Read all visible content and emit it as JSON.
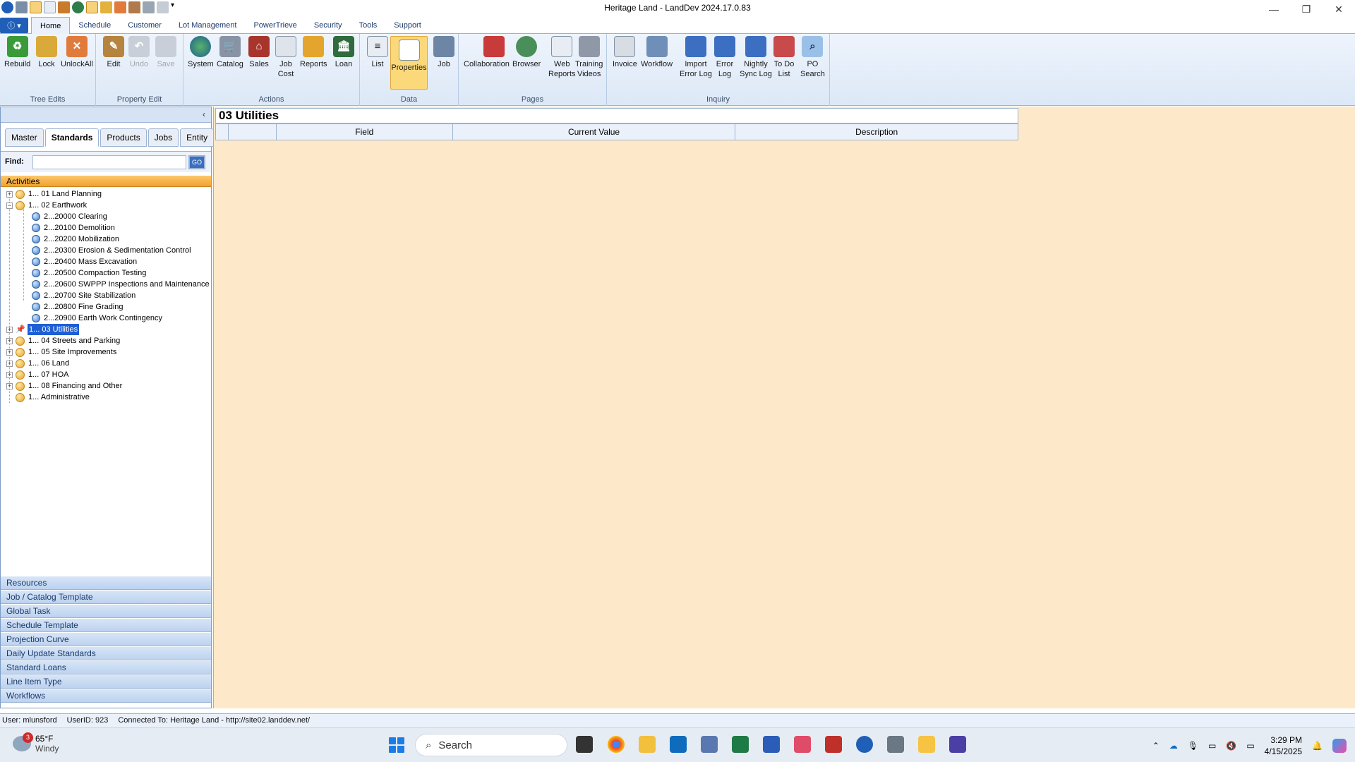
{
  "window": {
    "title": "Heritage Land - LandDev 2024.17.0.83",
    "controls": {
      "minimize": "—",
      "restore": "❐",
      "close": "✕"
    }
  },
  "app_menu_label": "ⓛ ▾",
  "ribbon_tabs": [
    "Home",
    "Schedule",
    "Customer",
    "Lot Management",
    "PowerTrieve",
    "Security",
    "Tools",
    "Support"
  ],
  "ribbon": {
    "groups": {
      "tree_edits": "Tree Edits",
      "property_edit": "Property Edit",
      "actions": "Actions",
      "data": "Data",
      "pages": "Pages",
      "inquiry": "Inquiry"
    },
    "buttons": {
      "rebuild": "Rebuild",
      "lock": "Lock",
      "unlockall": "UnlockAll",
      "edit": "Edit",
      "undo": "Undo",
      "save": "Save",
      "system": "System",
      "catalog": "Catalog",
      "sales": "Sales",
      "job_cost_1": "Job",
      "job_cost_2": "Cost",
      "reports": "Reports",
      "loan": "Loan",
      "list": "List",
      "properties": "Properties",
      "job": "Job",
      "collaboration": "Collaboration",
      "browser": "Browser",
      "web_reports_1": "Web",
      "web_reports_2": "Reports",
      "training_1": "Training",
      "training_2": "Videos",
      "invoice": "Invoice",
      "workflow": "Workflow",
      "import_1": "Import",
      "import_2": "Error Log",
      "error_1": "Error",
      "error_2": "Log",
      "nightly_1": "Nightly",
      "nightly_2": "Sync Log",
      "todo_1": "To Do",
      "todo_2": "List",
      "po_1": "PO",
      "po_2": "Search"
    }
  },
  "left_panel": {
    "collapse_icon": "‹",
    "tabs": [
      "Master",
      "Standards",
      "Products",
      "Jobs",
      "Entity"
    ],
    "find_label": "Find:",
    "find_value": "",
    "find_go": "GO",
    "section": "Activities",
    "tree": [
      {
        "label": "1... 01 Land Planning"
      },
      {
        "label": "1... 02 Earthwork"
      },
      {
        "label": "2...20000 Clearing"
      },
      {
        "label": "2...20100 Demolition"
      },
      {
        "label": "2...20200 Mobilization"
      },
      {
        "label": "2...20300 Erosion & Sedimentation Control"
      },
      {
        "label": "2...20400 Mass Excavation"
      },
      {
        "label": "2...20500 Compaction Testing"
      },
      {
        "label": "2...20600 SWPPP Inspections and Maintenance"
      },
      {
        "label": "2...20700 Site Stabilization"
      },
      {
        "label": "2...20800 Fine Grading"
      },
      {
        "label": "2...20900 Earth Work Contingency"
      },
      {
        "label": "1... 03 Utilities"
      },
      {
        "label": "1... 04 Streets and Parking"
      },
      {
        "label": "1... 05 Site Improvements"
      },
      {
        "label": "1... 06 Land"
      },
      {
        "label": "1... 07 HOA"
      },
      {
        "label": "1... 08 Financing and Other"
      },
      {
        "label": "1... Administrative"
      }
    ],
    "bottom_nav": [
      "Resources",
      "Job / Catalog Template",
      "Global Task",
      "Schedule Template",
      "Projection Curve",
      "Daily Update Standards",
      "Standard Loans",
      "Line Item Type",
      "Workflows"
    ]
  },
  "main": {
    "title": "03 Utilities",
    "columns": [
      "Field",
      "Current Value",
      "Description"
    ]
  },
  "status_bar": {
    "user": "User: mlunsford",
    "userid": "UserID: 923",
    "connected": "Connected To: Heritage Land  -  http://site02.landdev.net/"
  },
  "taskbar": {
    "weather_temp": "65°F",
    "weather_desc": "Windy",
    "weather_badge": "3",
    "search_placeholder": "Search",
    "time": "3:29 PM",
    "date": "4/15/2025"
  }
}
